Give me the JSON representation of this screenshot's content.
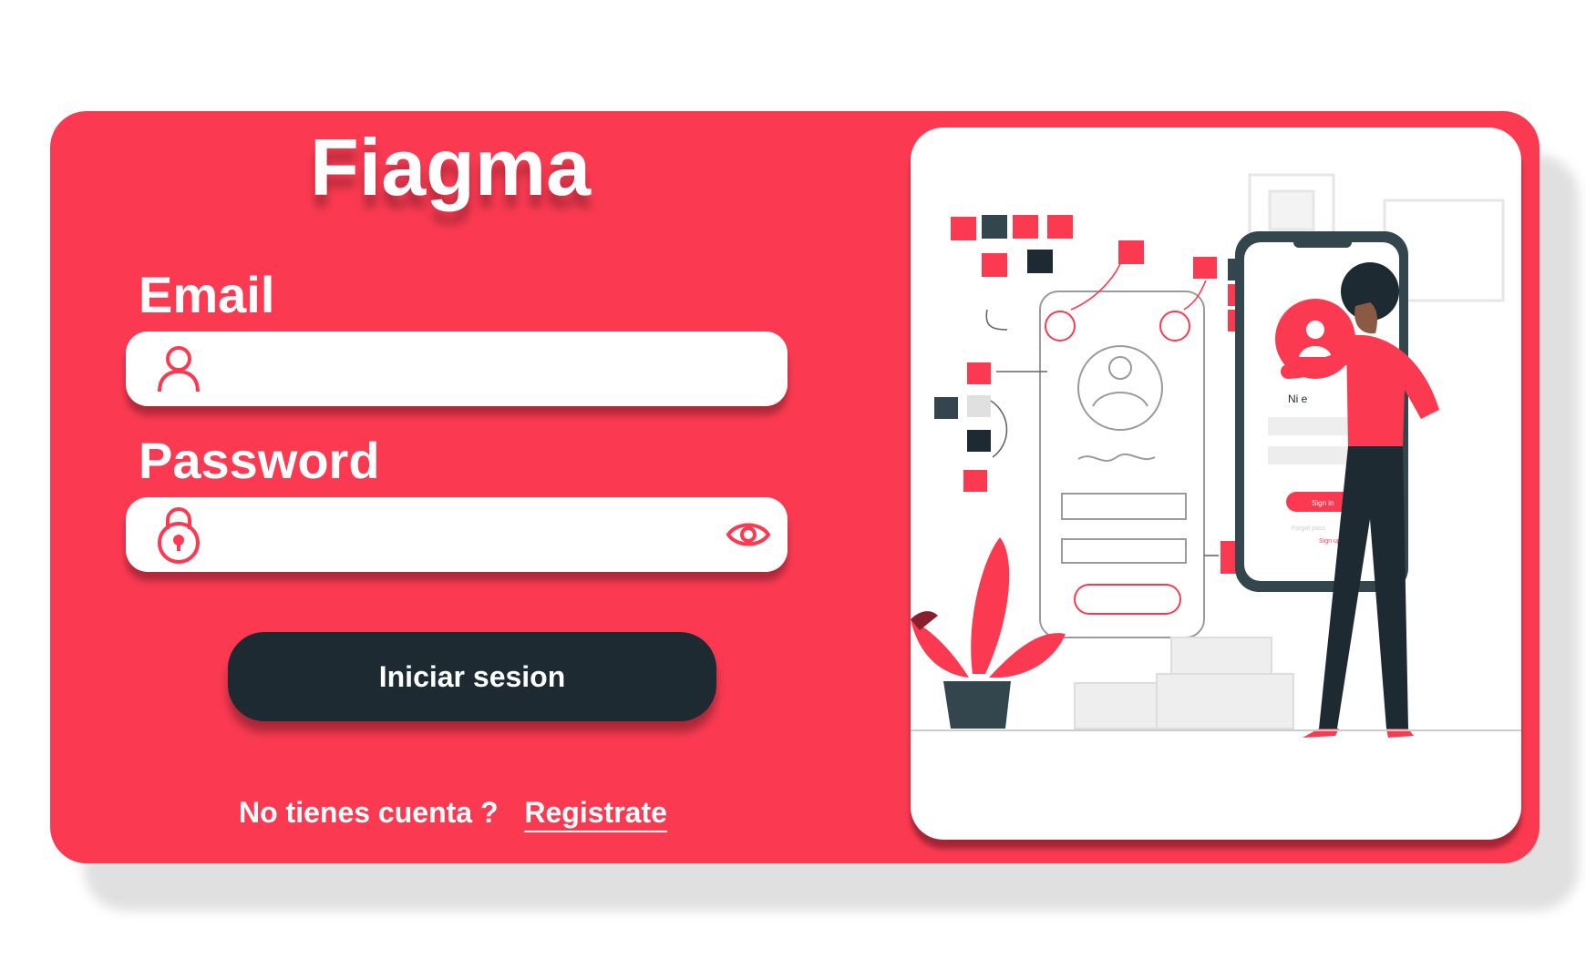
{
  "brand": {
    "title": "Fiagma"
  },
  "form": {
    "email_label": "Email",
    "email_value": "",
    "email_placeholder": "",
    "password_label": "Password",
    "password_value": "",
    "password_placeholder": "",
    "submit_label": "Iniciar sesion"
  },
  "footer": {
    "question": "No tienes cuenta ?",
    "register_link": "Registrate"
  },
  "illustration": {
    "phone_name_label": "Ni        e",
    "phone_signin_label": "Sign in",
    "phone_forgot_label": "Forgot pass",
    "phone_signup_label": "Sign up"
  },
  "colors": {
    "accent": "#fb3a52",
    "dark": "#1d2a31",
    "panel": "#ffffff"
  },
  "icons": [
    "user-icon",
    "lock-icon",
    "eye-icon"
  ]
}
